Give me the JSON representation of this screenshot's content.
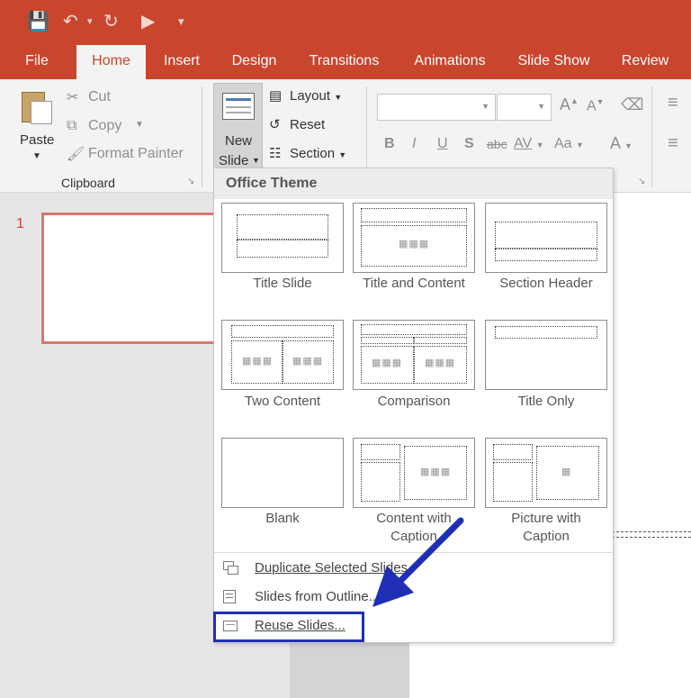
{
  "tabs": [
    "File",
    "Home",
    "Insert",
    "Design",
    "Transitions",
    "Animations",
    "Slide Show",
    "Review"
  ],
  "clipboard": {
    "paste": "Paste",
    "cut": "Cut",
    "copy": "Copy",
    "format_painter": "Format Painter",
    "group": "Clipboard"
  },
  "slides": {
    "new_slide_1": "New",
    "new_slide_2": "Slide",
    "layout": "Layout",
    "reset": "Reset",
    "section": "Section"
  },
  "font": {
    "bold": "B",
    "italic": "I",
    "underline": "U",
    "strike": "S",
    "abc": "abc",
    "spacing": "AV",
    "aa": "Aa",
    "font_color": "A"
  },
  "thumbnail": {
    "number": "1"
  },
  "dropdown": {
    "header": "Office Theme",
    "layouts": [
      "Title Slide",
      "Title and Content",
      "Section Header",
      "Two Content",
      "Comparison",
      "Title Only",
      "Blank",
      "Content with Caption",
      "Picture with Caption"
    ],
    "layout_lines": {
      "content_caption_1": "Content with",
      "content_caption_2": "Caption",
      "picture_caption_1": "Picture with",
      "picture_caption_2": "Caption"
    },
    "menu": {
      "duplicate": "Duplicate Selected Slides",
      "outline": "Slides from Outline...",
      "reuse": "Reuse Slides..."
    }
  },
  "colors": {
    "accent": "#c9452e",
    "highlight_box": "#1f2fb5",
    "arrow": "#1f2fb5"
  }
}
